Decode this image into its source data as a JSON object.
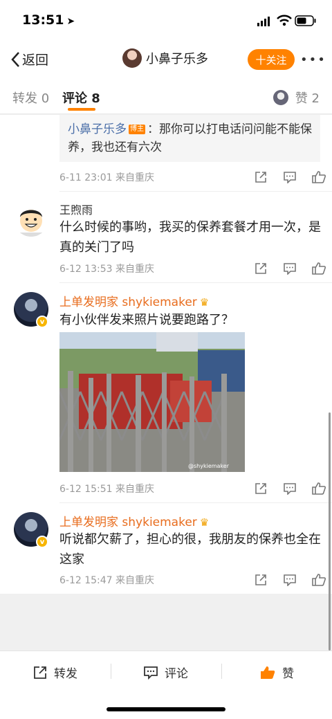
{
  "status_bar": {
    "time": "13:51"
  },
  "navbar": {
    "back_label": "返回",
    "title": "小鼻子乐多",
    "follow_label": "十关注",
    "more_label": "•••"
  },
  "tabs": {
    "forward": "转发 0",
    "comment": "评论 8",
    "like": "赞 2"
  },
  "quoted_reply": {
    "author": "小鼻子乐多",
    "badge": "博主",
    "text": "：那你可以打电话问问能不能保养，我也还有六次",
    "meta": "6-11 23:01  来自重庆"
  },
  "comments": [
    {
      "author": "王煦雨",
      "text": "什么时候的事哟，我买的保养套餐才用一次，是真的关门了吗",
      "meta": "6-12 13:53  来自重庆"
    },
    {
      "author": "上单发明家 shykiemaker",
      "text": "有小伙伴发来照片说要跑路了？",
      "meta": "6-12 15:51  来自重庆",
      "photo_caption": "@shykiemaker"
    },
    {
      "author": "上单发明家 shykiemaker",
      "text": "听说都欠薪了，担心的很，我朋友的保养也全在这家",
      "meta": "6-12 15:47  来自重庆"
    }
  ],
  "bottom_bar": {
    "forward": "转发",
    "comment": "评论",
    "like": "赞"
  },
  "colors": {
    "accent": "#ff8200",
    "link": "#4a6ea8",
    "vip_name": "#e86c1d"
  },
  "icons": [
    "location-arrow-icon",
    "signal-icon",
    "wifi-icon",
    "battery-icon",
    "back-chevron-icon",
    "share-icon",
    "comment-icon",
    "like-icon",
    "crown-icon",
    "verified-icon"
  ]
}
